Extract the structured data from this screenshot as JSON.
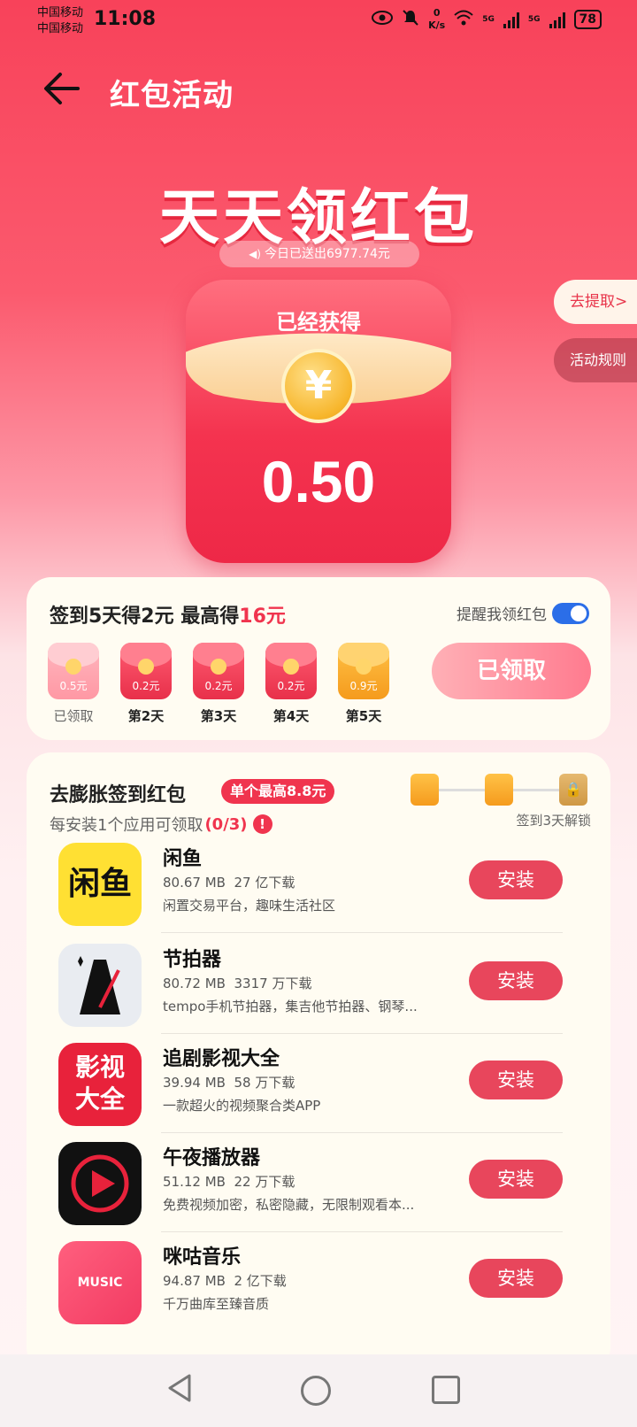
{
  "status": {
    "carrier1": "中国移动",
    "carrier2": "中国移动",
    "time": "11:08",
    "net_speed_value": "0",
    "net_speed_unit": "K/s",
    "network1": "5G",
    "network2": "5G",
    "battery": "78"
  },
  "header": {
    "title": "红包活动"
  },
  "hero": {
    "title": "天天领红包",
    "ticker": "今日已送出6977.74元",
    "withdraw": "去提取>",
    "rules": "活动规则",
    "envelope_label": "已经获得",
    "coin_symbol": "¥",
    "amount": "0.50"
  },
  "checkin": {
    "title_prefix": "签到5天得2元 最高得",
    "title_highlight": "16元",
    "remind_label": "提醒我领红包",
    "remind_on": true,
    "claim_button": "已领取",
    "days": [
      {
        "amount": "0.5元",
        "label": "已领取",
        "state": "claimed"
      },
      {
        "amount": "0.2元",
        "label": "第2天",
        "state": "pending"
      },
      {
        "amount": "0.2元",
        "label": "第3天",
        "state": "pending"
      },
      {
        "amount": "0.2元",
        "label": "第4天",
        "state": "pending"
      },
      {
        "amount": "0.9元",
        "label": "第5天",
        "state": "gold"
      }
    ]
  },
  "apps_section": {
    "title": "去膨胀签到红包",
    "badge": "单个最高8.8元",
    "subtitle": "每安装1个应用可领取",
    "progress": "(0/3)",
    "unlock_note": "签到3天解锁",
    "install_label": "安装",
    "apps": [
      {
        "name": "闲鱼",
        "size": "80.67 MB",
        "downloads": "27 亿下载",
        "desc": "闲置交易平台，趣味生活社区",
        "icon_text": "闲鱼"
      },
      {
        "name": "节拍器",
        "size": "80.72 MB",
        "downloads": "3317 万下载",
        "desc": "tempo手机节拍器，集吉他节拍器、钢琴...",
        "icon_text": ""
      },
      {
        "name": "追剧影视大全",
        "size": "39.94 MB",
        "downloads": "58 万下载",
        "desc": "一款超火的视频聚合类APP",
        "icon_text": "影视大全"
      },
      {
        "name": "午夜播放器",
        "size": "51.12 MB",
        "downloads": "22 万下载",
        "desc": "免费视频加密，私密隐藏，无限制观看本...",
        "icon_text": ""
      },
      {
        "name": "咪咕音乐",
        "size": "94.87 MB",
        "downloads": "2 亿下载",
        "desc": "千万曲库至臻音质",
        "icon_text": "MUSIC"
      }
    ]
  },
  "colors": {
    "primary": "#f0344e",
    "toggle": "#2b6ee8",
    "gold": "#f59b1d"
  }
}
